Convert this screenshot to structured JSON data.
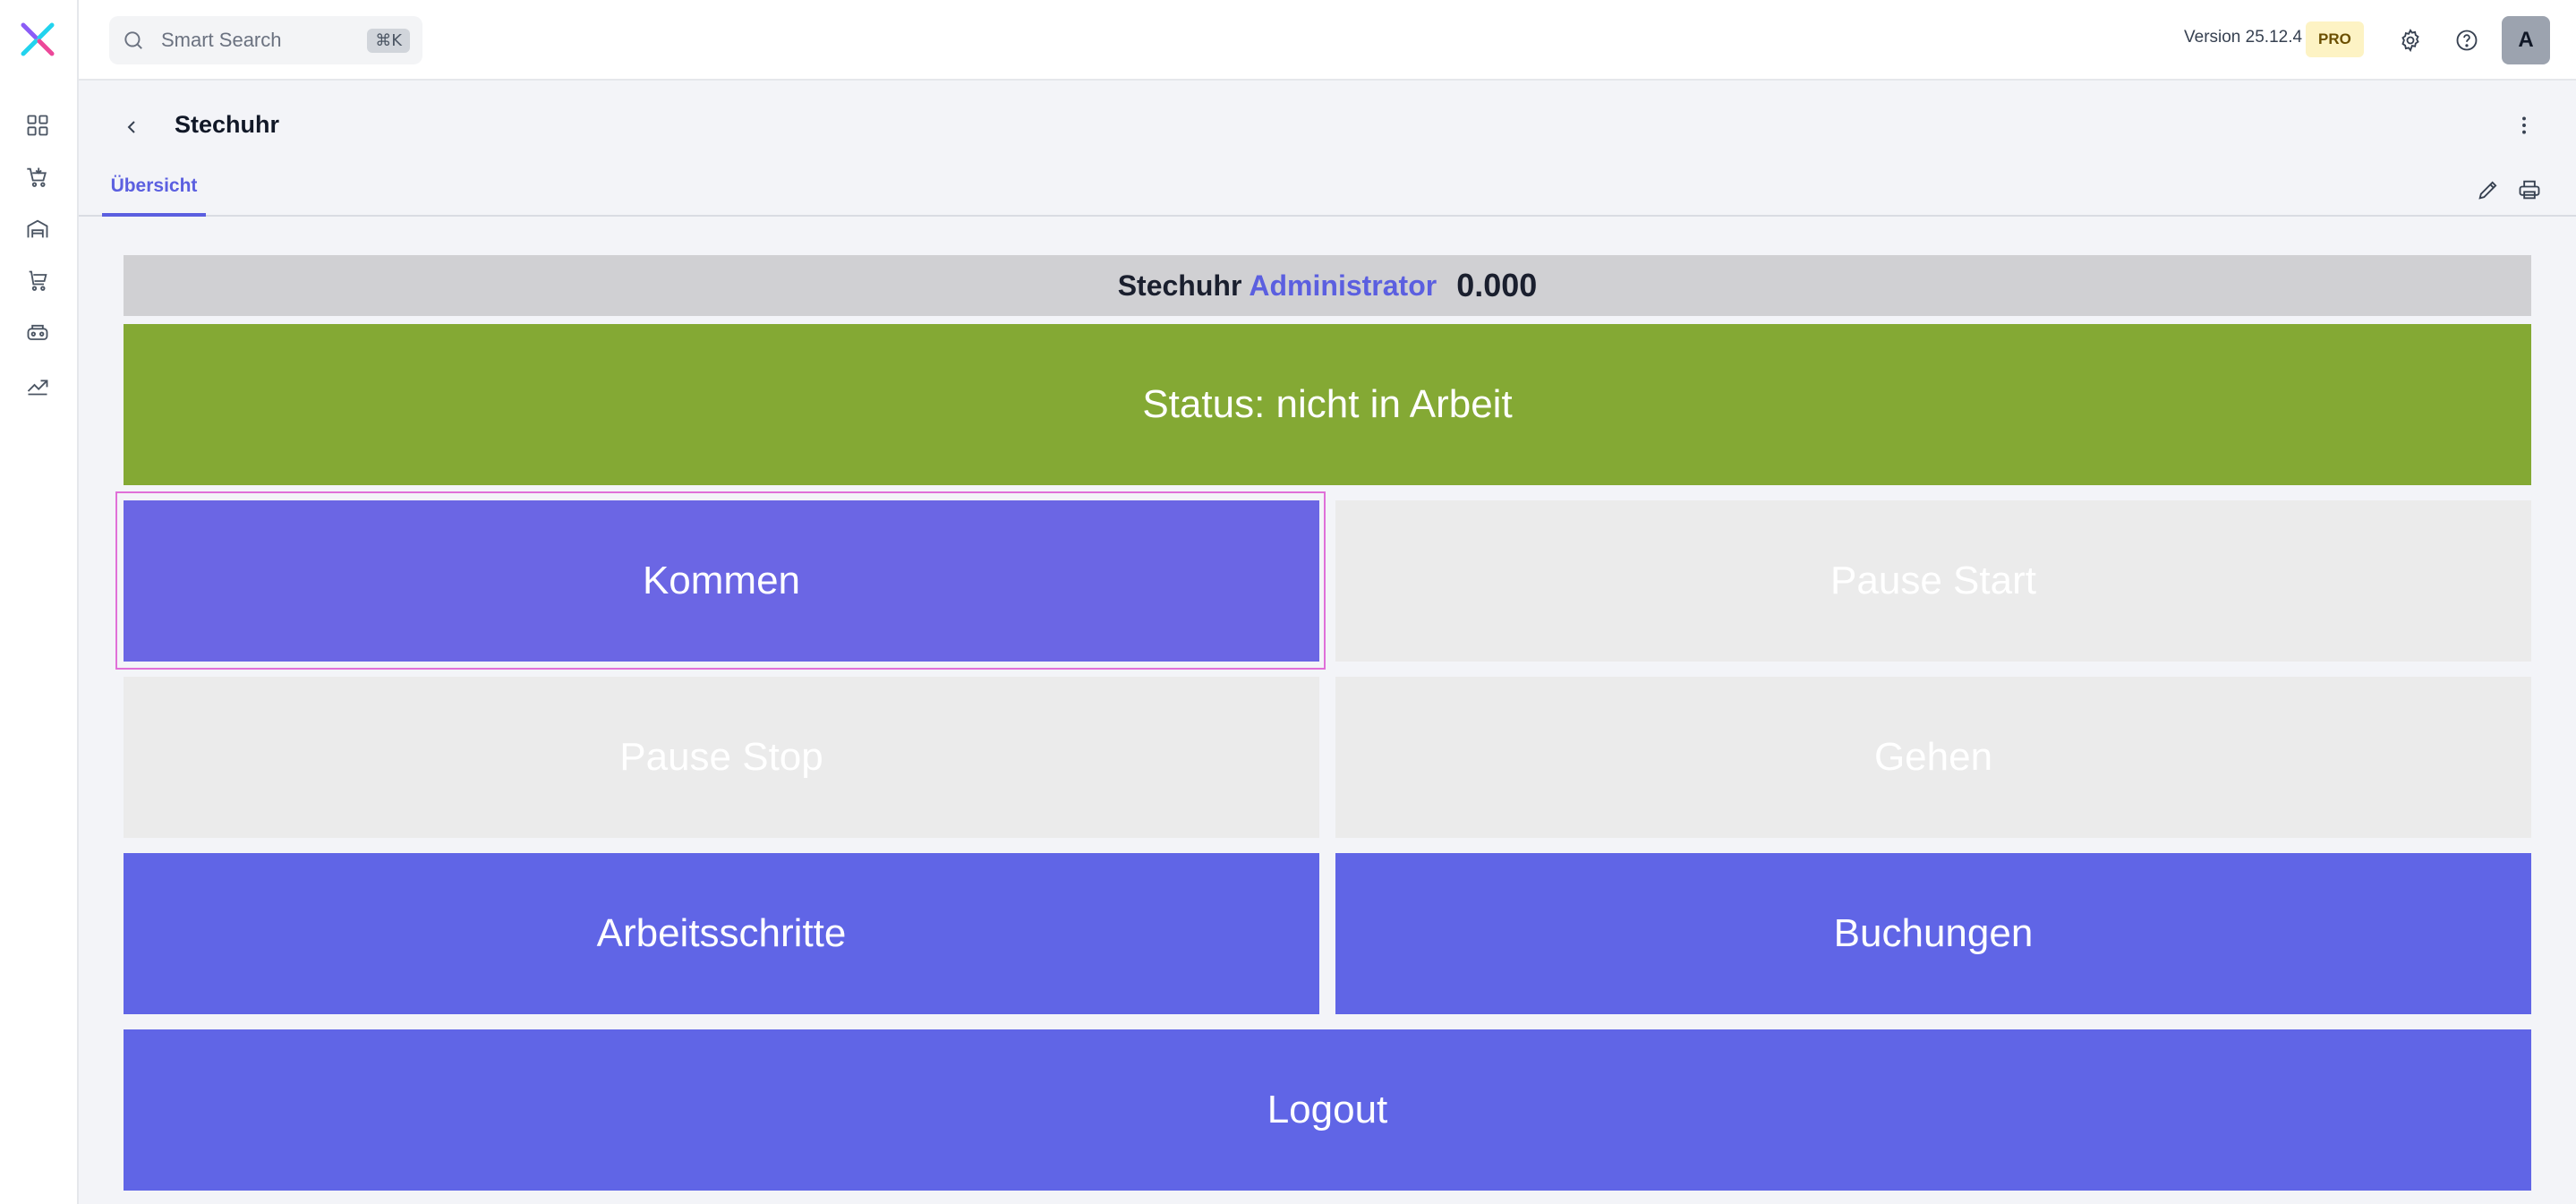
{
  "sidebar": {
    "logo": "app-logo",
    "items": [
      {
        "name": "dashboard-icon"
      },
      {
        "name": "sales-cart-icon"
      },
      {
        "name": "warehouse-icon"
      },
      {
        "name": "purchasing-cart-icon"
      },
      {
        "name": "production-icon"
      },
      {
        "name": "analytics-icon"
      }
    ]
  },
  "topbar": {
    "search_placeholder": "Smart Search",
    "search_shortcut": "⌘K",
    "version": "Version 25.12.4",
    "badge": "PRO",
    "avatar_initial": "A"
  },
  "page": {
    "title": "Stechuhr",
    "tab": "Übersicht"
  },
  "clock": {
    "label": "Stechuhr",
    "user": "Administrator",
    "value": "0.000",
    "status": "Status: nicht in Arbeit",
    "buttons": {
      "kommen": "Kommen",
      "pause_start": "Pause Start",
      "pause_stop": "Pause Stop",
      "gehen": "Gehen",
      "arbeitsschritte": "Arbeitsschritte",
      "buchungen": "Buchungen",
      "logout": "Logout"
    }
  },
  "colors": {
    "accent": "#5b5fe0",
    "status_green": "#84a934",
    "button_blue": "#6065e6",
    "disabled": "#ebebeb",
    "header_bar": "#d0d0d3"
  }
}
